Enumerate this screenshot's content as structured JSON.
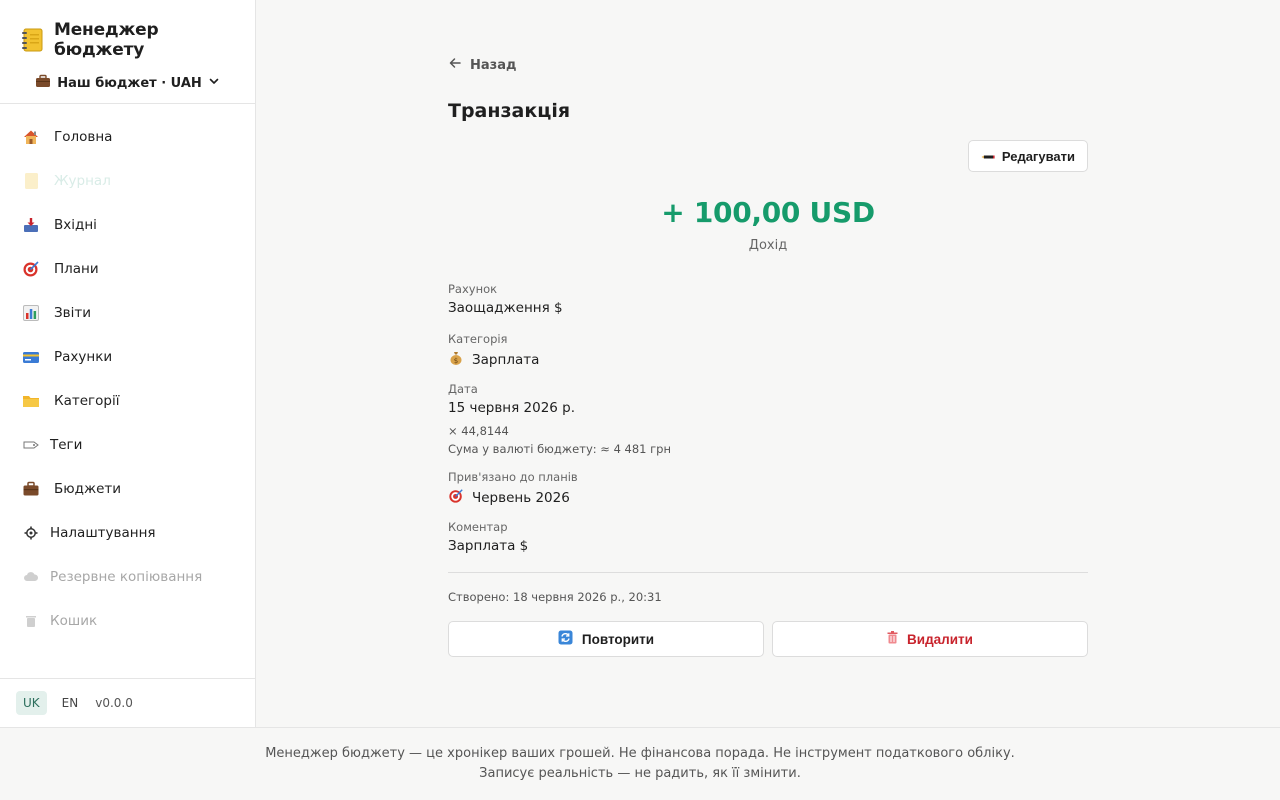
{
  "app": {
    "title": "Менеджер бюджету",
    "budget_selector": "Наш бюджет · UAH"
  },
  "sidebar": {
    "items": [
      {
        "label": "Головна",
        "icon": "home-icon"
      },
      {
        "label": "Журнал",
        "icon": "notebook-icon"
      },
      {
        "label": "Вхідні",
        "icon": "inbox-icon"
      },
      {
        "label": "Плани",
        "icon": "target-icon"
      },
      {
        "label": "Звіти",
        "icon": "chart-icon"
      },
      {
        "label": "Рахунки",
        "icon": "credit-card-icon"
      },
      {
        "label": "Категорії",
        "icon": "folder-icon"
      },
      {
        "label": "Теги",
        "icon": "tag-icon"
      },
      {
        "label": "Бюджети",
        "icon": "briefcase-icon"
      },
      {
        "label": "Налаштування",
        "icon": "gear-icon"
      },
      {
        "label": "Резервне копіювання",
        "icon": "cloud-icon"
      },
      {
        "label": "Кошик",
        "icon": "trash-icon"
      }
    ]
  },
  "languages": {
    "uk": "UK",
    "en": "EN"
  },
  "version": "v0.0.0",
  "page": {
    "back_label": "Назад",
    "title": "Транзакція",
    "edit_label": "Редагувати",
    "amount": "+ 100,00 USD",
    "amount_type": "Дохід",
    "fields": {
      "account_label": "Рахунок",
      "account_value": "Заощадження $",
      "category_label": "Категорія",
      "category_value": "Зарплата",
      "date_label": "Дата",
      "date_value": "15 червня 2026 р.",
      "rate": "× 44,8144",
      "budget_currency_sum": "Сума у валюті бюджету: ≈ 4 481 грн",
      "plans_label": "Прив'язано до планів",
      "plans_value": "Червень 2026",
      "comment_label": "Коментар",
      "comment_value": "Зарплата $"
    },
    "created": "Створено: 18 червня 2026 р., 20:31",
    "repeat_label": "Повторити",
    "delete_label": "Видалити"
  },
  "footer": {
    "text": "Менеджер бюджету — це хронікер ваших грошей. Не фінансова порада. Не інструмент податкового обліку. Записує реальність — не радить, як її змінити."
  },
  "colors": {
    "income": "#169b6b",
    "delete": "#c8232c",
    "active_lang_bg": "#e3f0ec"
  }
}
